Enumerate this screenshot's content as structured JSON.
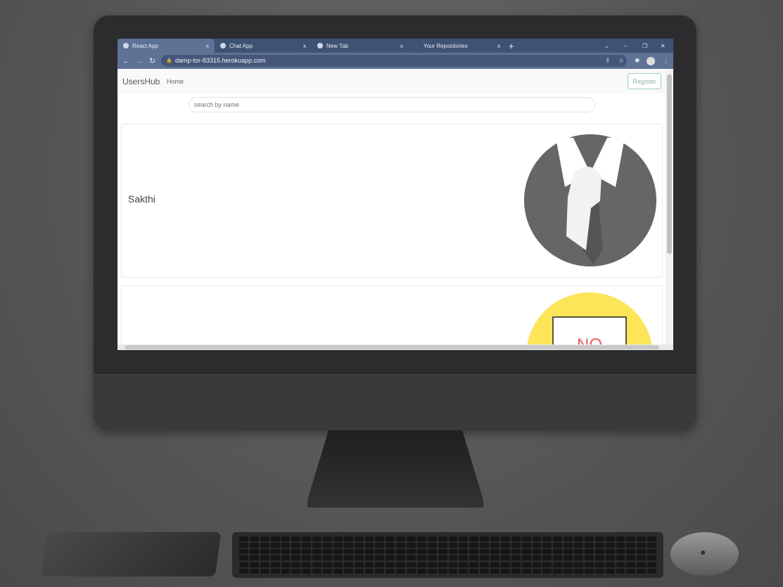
{
  "browser": {
    "tabs": [
      {
        "label": "React App",
        "close": "x",
        "active": true
      },
      {
        "label": "Chat App",
        "close": "x"
      },
      {
        "label": "New Tab",
        "close": "x"
      },
      {
        "label": "Your Repositories",
        "close": "x"
      }
    ],
    "new_tab": "+",
    "window_controls": {
      "dropdown": "⌄",
      "minimize": "−",
      "restore": "❐",
      "close": "✕"
    },
    "url": "damp-tor-83315.herokuapp.com"
  },
  "app": {
    "brand": "UsersHub",
    "nav_home": "Home",
    "register": "Register",
    "search_placeholder": "search by name",
    "users": [
      {
        "name": "Sakthi",
        "avatar": "suit-tie-avatar"
      },
      {
        "name": "",
        "avatar": "no-sign-avatar",
        "avatar_text": "NO"
      }
    ]
  },
  "colors": {
    "tabbar": "#3e5274",
    "register_border": "#9ccfae",
    "avatar_bg": "#666666",
    "avatar2_bg": "#fde55a"
  }
}
